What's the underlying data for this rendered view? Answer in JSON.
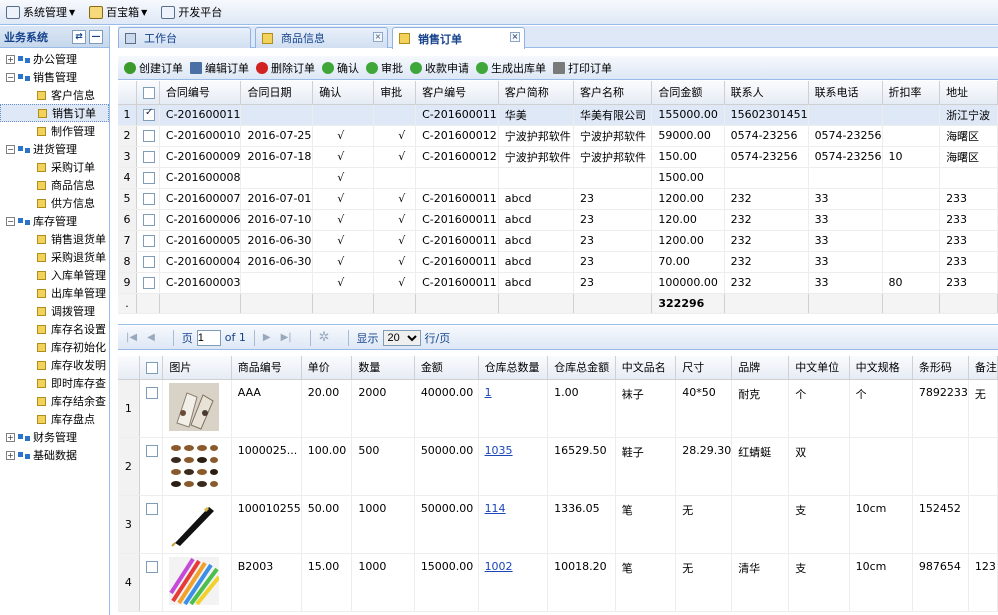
{
  "topmenu": [
    {
      "label": "系统管理",
      "icon": "system-icon",
      "dropdown": true
    },
    {
      "label": "百宝箱",
      "icon": "toolbox-icon",
      "dropdown": true
    },
    {
      "label": "开发平台",
      "icon": "devplatform-icon",
      "dropdown": false
    }
  ],
  "sidebar": {
    "title": "业务系统",
    "refresh_label": "⇄",
    "collapse_label": "—",
    "tree": [
      {
        "label": "办公管理",
        "type": "group",
        "expanded": false
      },
      {
        "label": "销售管理",
        "type": "group",
        "expanded": true
      },
      {
        "label": "客户信息",
        "type": "leaf"
      },
      {
        "label": "销售订单",
        "type": "leaf",
        "selected": true
      },
      {
        "label": "制作管理",
        "type": "leaf"
      },
      {
        "label": "进货管理",
        "type": "group",
        "expanded": true
      },
      {
        "label": "采购订单",
        "type": "leaf"
      },
      {
        "label": "商品信息",
        "type": "leaf"
      },
      {
        "label": "供方信息",
        "type": "leaf"
      },
      {
        "label": "库存管理",
        "type": "group",
        "expanded": true
      },
      {
        "label": "销售退货单",
        "type": "leaf"
      },
      {
        "label": "采购退货单",
        "type": "leaf"
      },
      {
        "label": "入库单管理",
        "type": "leaf"
      },
      {
        "label": "出库单管理",
        "type": "leaf"
      },
      {
        "label": "调拨管理",
        "type": "leaf"
      },
      {
        "label": "库存名设置",
        "type": "leaf"
      },
      {
        "label": "库存初始化",
        "type": "leaf"
      },
      {
        "label": "库存收发明",
        "type": "leaf"
      },
      {
        "label": "即时库存查",
        "type": "leaf"
      },
      {
        "label": "库存结余查",
        "type": "leaf"
      },
      {
        "label": "库存盘点",
        "type": "leaf"
      },
      {
        "label": "财务管理",
        "type": "group",
        "expanded": false
      },
      {
        "label": "基础数据",
        "type": "group",
        "expanded": false
      }
    ]
  },
  "tabs": [
    {
      "label": "工作台",
      "closable": false,
      "active": false
    },
    {
      "label": "商品信息",
      "closable": true,
      "active": false
    },
    {
      "label": "销售订单",
      "closable": true,
      "active": true
    }
  ],
  "toolbar": [
    {
      "label": "创建订单",
      "icon": "add-icon",
      "color": "#3a9a2a"
    },
    {
      "label": "编辑订单",
      "icon": "edit-icon",
      "color": "#4a6fa5"
    },
    {
      "label": "删除订单",
      "icon": "delete-icon",
      "color": "#d22222"
    },
    {
      "label": "确认",
      "icon": "check-icon",
      "color": "#3fa63a"
    },
    {
      "label": "审批",
      "icon": "check-icon",
      "color": "#3fa63a"
    },
    {
      "label": "收款申请",
      "icon": "check-icon",
      "color": "#3fa63a"
    },
    {
      "label": "生成出库单",
      "icon": "check-icon",
      "color": "#3fa63a"
    },
    {
      "label": "打印订单",
      "icon": "print-icon",
      "color": "#7a7a7a"
    }
  ],
  "orders": {
    "columns": [
      "合同编号",
      "合同日期",
      "确认",
      "审批",
      "客户编号",
      "客户简称",
      "客户名称",
      "合同金额",
      "联系人",
      "联系电话",
      "折扣率",
      "地址"
    ],
    "rows": [
      {
        "n": "1",
        "checked": true,
        "cells": [
          "C-201600011",
          "",
          "",
          "",
          "C-201600011",
          "华美",
          "华美有限公司",
          "155000.00",
          "15602301451",
          "",
          "",
          "浙江宁波"
        ]
      },
      {
        "n": "2",
        "checked": false,
        "cells": [
          "C-201600010",
          "2016-07-25",
          "√",
          "√",
          "C-201600012",
          "宁波护邦软件",
          "宁波护邦软件",
          "59000.00",
          "0574-23256",
          "0574-23256",
          "",
          "海曙区"
        ]
      },
      {
        "n": "3",
        "checked": false,
        "cells": [
          "C-201600009",
          "2016-07-18",
          "√",
          "√",
          "C-201600012",
          "宁波护邦软件",
          "宁波护邦软件",
          "150.00",
          "0574-23256",
          "0574-23256",
          "10",
          "海曙区"
        ]
      },
      {
        "n": "4",
        "checked": false,
        "cells": [
          "C-201600008",
          "",
          "√",
          "",
          "",
          "",
          "",
          "1500.00",
          "",
          "",
          "",
          ""
        ]
      },
      {
        "n": "5",
        "checked": false,
        "cells": [
          "C-201600007",
          "2016-07-01",
          "√",
          "√",
          "C-201600011",
          "abcd",
          "23",
          "1200.00",
          "232",
          "33",
          "",
          "233"
        ]
      },
      {
        "n": "6",
        "checked": false,
        "cells": [
          "C-201600006",
          "2016-07-10",
          "√",
          "√",
          "C-201600011",
          "abcd",
          "23",
          "120.00",
          "232",
          "33",
          "",
          "233"
        ]
      },
      {
        "n": "7",
        "checked": false,
        "cells": [
          "C-201600005",
          "2016-06-30",
          "√",
          "√",
          "C-201600011",
          "abcd",
          "23",
          "1200.00",
          "232",
          "33",
          "",
          "233"
        ]
      },
      {
        "n": "8",
        "checked": false,
        "cells": [
          "C-201600004",
          "2016-06-30",
          "√",
          "√",
          "C-201600011",
          "abcd",
          "23",
          "70.00",
          "232",
          "33",
          "",
          "233"
        ]
      },
      {
        "n": "9",
        "checked": false,
        "cells": [
          "C-201600003",
          "",
          "√",
          "√",
          "C-201600011",
          "abcd",
          "23",
          "100000.00",
          "232",
          "33",
          "80",
          "233"
        ]
      }
    ],
    "summary_marker": ".",
    "total_amount": "322296"
  },
  "pager": {
    "page_label": "页",
    "page_value": "1",
    "of_label": "of 1",
    "show_label": "显示",
    "page_size": "20",
    "per_page_label": "行/页"
  },
  "items": {
    "columns": [
      "图片",
      "商品编号",
      "单价",
      "数量",
      "金额",
      "仓库总数量",
      "仓库总金额",
      "中文品名",
      "尺寸",
      "品牌",
      "中文单位",
      "中文规格",
      "条形码",
      "备注"
    ],
    "rows": [
      {
        "n": "1",
        "image": "socks-photo",
        "cells": [
          "AAA",
          "20.00",
          "2000",
          "40000.00",
          "1",
          "1.00",
          "袜子",
          "40*50",
          "耐克",
          "个",
          "个",
          "7892233",
          "无"
        ]
      },
      {
        "n": "2",
        "image": "shoes-photo",
        "cells": [
          "1000025...",
          "100.00",
          "500",
          "50000.00",
          "1035",
          "16529.50",
          "鞋子",
          "28.29.30",
          "红蜻蜓",
          "双",
          "",
          "",
          ""
        ]
      },
      {
        "n": "3",
        "image": "pen-photo",
        "cells": [
          "100010255",
          "50.00",
          "1000",
          "50000.00",
          "114",
          "1336.05",
          "笔",
          "无",
          "",
          "支",
          "10cm",
          "152452",
          ""
        ]
      },
      {
        "n": "4",
        "image": "pencils-photo",
        "cells": [
          "B2003",
          "15.00",
          "1000",
          "15000.00",
          "1002",
          "10018.20",
          "笔",
          "无",
          "清华",
          "支",
          "10cm",
          "987654",
          "123"
        ]
      }
    ]
  }
}
